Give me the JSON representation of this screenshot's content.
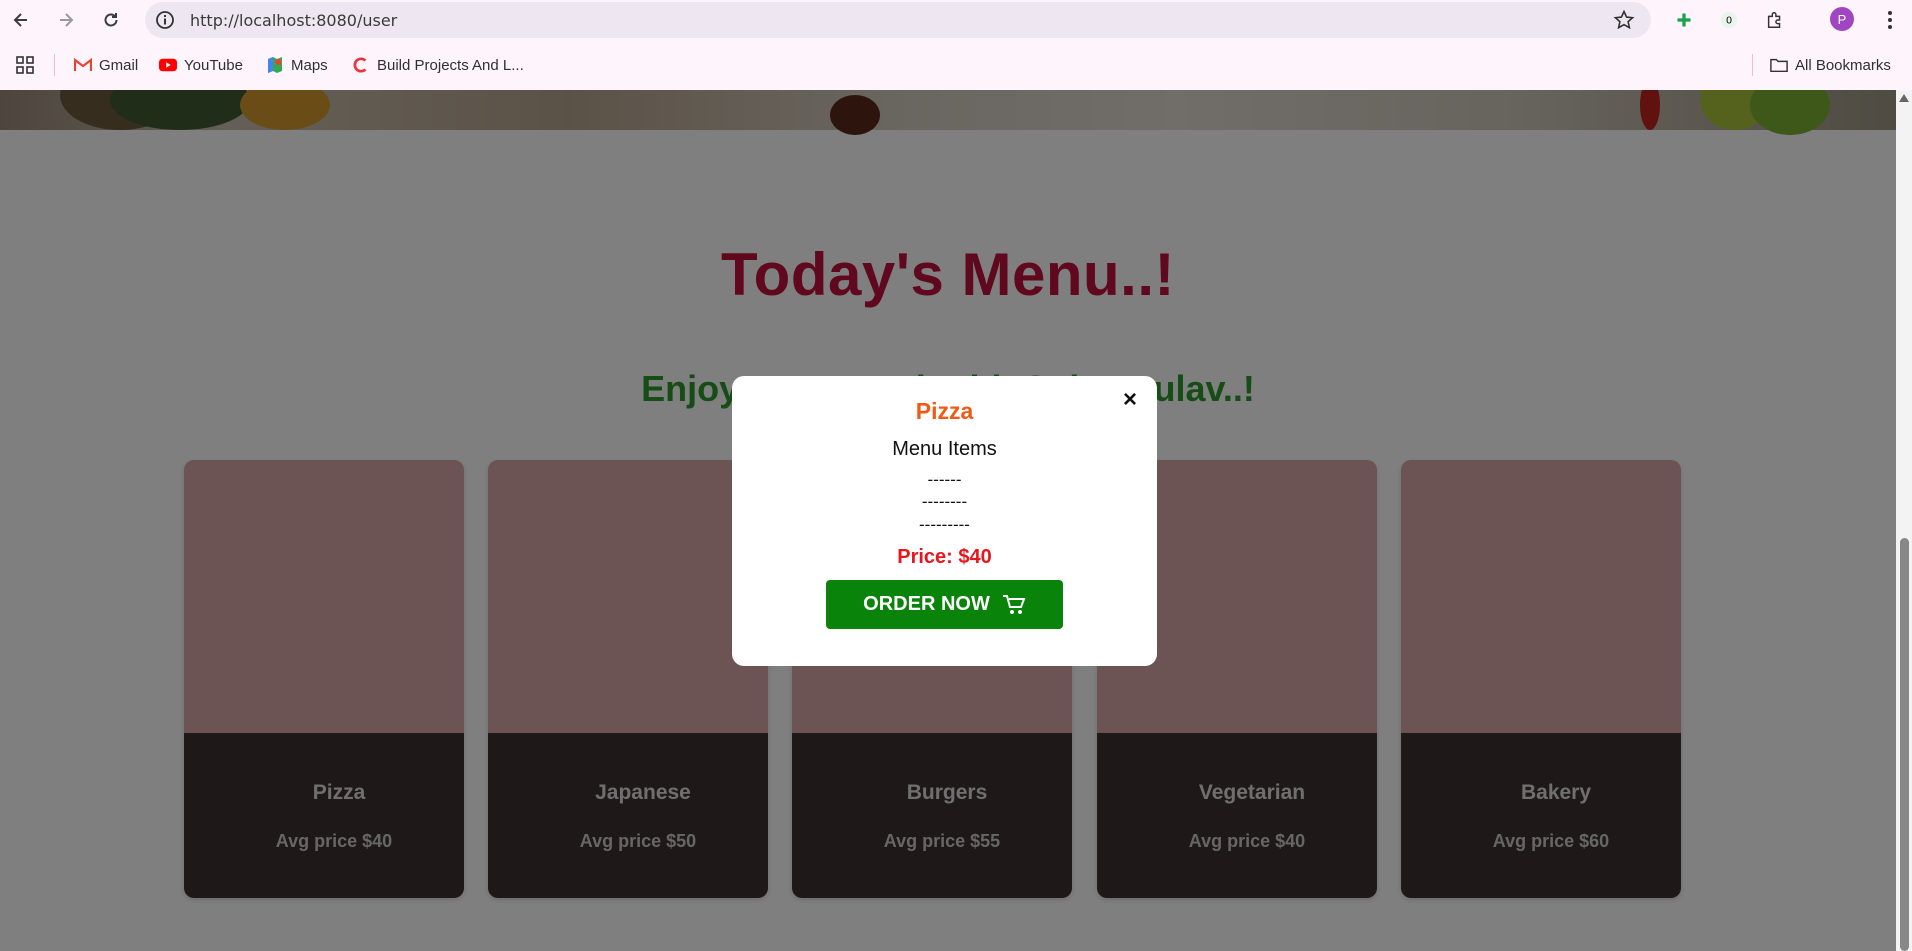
{
  "browser": {
    "url": "http://localhost:8080/user",
    "profile_initial": "P",
    "bookmarks": [
      {
        "label": "Gmail",
        "icon": "gmail-icon"
      },
      {
        "label": "YouTube",
        "icon": "youtube-icon"
      },
      {
        "label": "Maps",
        "icon": "maps-icon"
      },
      {
        "label": "Build Projects And L...",
        "icon": "c-logo-icon"
      }
    ],
    "all_bookmarks": "All Bookmarks"
  },
  "page": {
    "title": "Today's Menu..!",
    "subtitle": "Enjoy Your Food With Spice Pulav..!",
    "cards": [
      {
        "name": "Pizza",
        "price": "Avg price $40"
      },
      {
        "name": "Japanese",
        "price": "Avg price $50"
      },
      {
        "name": "Burgers",
        "price": "Avg price $55"
      },
      {
        "name": "Vegetarian",
        "price": "Avg price $40"
      },
      {
        "name": "Bakery",
        "price": "Avg price $60"
      }
    ]
  },
  "modal": {
    "title": "Pizza",
    "items_label": "Menu Items",
    "dash_lines": [
      "------",
      "--------",
      "---------"
    ],
    "price": "Price: $40",
    "order_label": "ORDER NOW",
    "close_glyph": "×"
  },
  "colors": {
    "title": "#c0103c",
    "subtitle": "#2b9a2b",
    "modal_title": "#f05a14",
    "modal_price": "#e8161c",
    "order_button": "#0a830a"
  }
}
